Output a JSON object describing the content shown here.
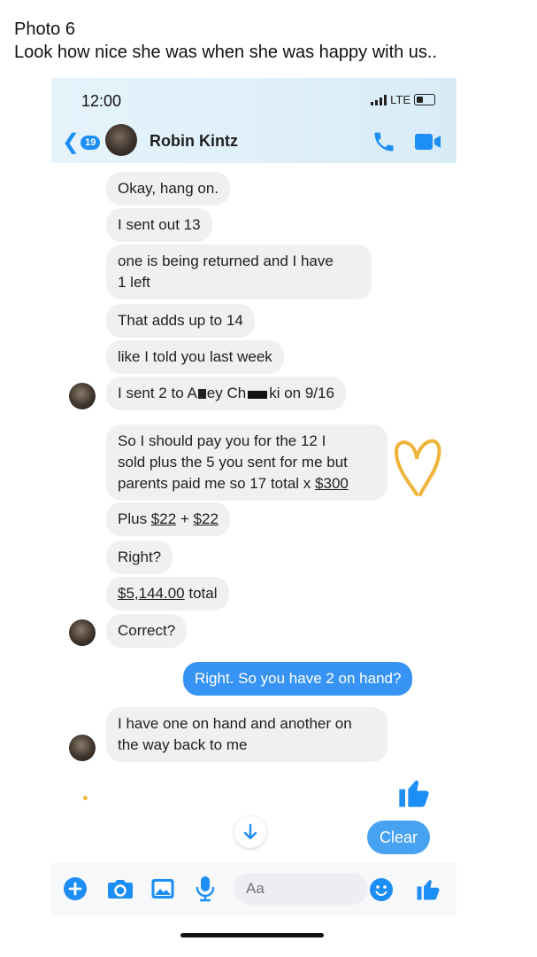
{
  "caption": {
    "title": "Photo 6",
    "subtitle": "Look how nice she was when she was happy with us.."
  },
  "status_bar": {
    "time": "12:00",
    "network": "LTE"
  },
  "header": {
    "back_badge": "19",
    "contact_name": "Robin Kintz"
  },
  "messages": [
    {
      "from": "contact",
      "text": "Okay, hang on."
    },
    {
      "from": "contact",
      "text": "I sent out 13"
    },
    {
      "from": "contact",
      "line1": "one is being returned and I have",
      "line2": "1 left"
    },
    {
      "from": "contact",
      "text": "That adds up to 14"
    },
    {
      "from": "contact",
      "text": "like I told you last week"
    },
    {
      "from": "contact",
      "part1": "I sent 2 to A",
      "part2": "ey Ch",
      "part3": "ki on 9/16"
    },
    {
      "from": "contact",
      "line1": "So I should pay you for the 12 I",
      "line2": "sold plus the 5 you sent for me but",
      "line3a": "parents paid me so 17 total x ",
      "line3b": "$300"
    },
    {
      "from": "contact",
      "a": "Plus ",
      "b": "$22",
      "c": " + ",
      "d": "$22"
    },
    {
      "from": "contact",
      "text": "Right?"
    },
    {
      "from": "contact",
      "a": "$5,144.00",
      "b": " total"
    },
    {
      "from": "contact",
      "text": "Correct?"
    },
    {
      "from": "me",
      "text": "Right. So you have 2 on hand?"
    },
    {
      "from": "contact",
      "line1": "I have one on hand and another on",
      "line2": "the way back to me"
    }
  ],
  "actions": {
    "clear_label": "Clear"
  },
  "composer": {
    "placeholder": "Aa"
  },
  "colors": {
    "accent": "#1d8ef5",
    "outgoing_bubble": "#3794f5",
    "incoming_bubble": "#f0f0f1",
    "heart": "#efb43a"
  },
  "icons": [
    "back-chevron-icon",
    "phone-icon",
    "video-icon",
    "heart-doodle-icon",
    "thumbs-up-icon",
    "down-arrow-icon",
    "plus-icon",
    "camera-icon",
    "image-icon",
    "microphone-icon",
    "emoji-icon"
  ]
}
